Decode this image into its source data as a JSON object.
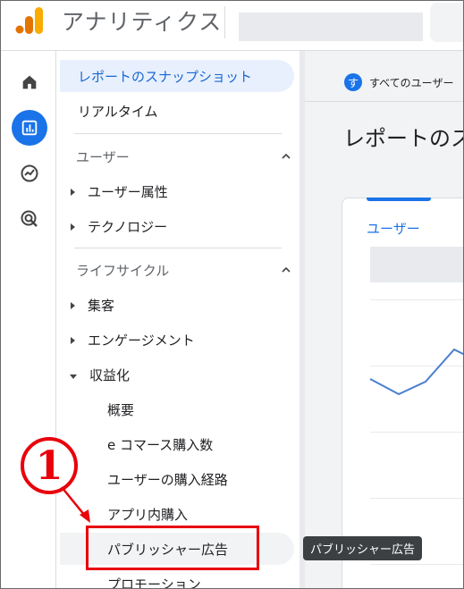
{
  "app": {
    "title": "アナリティクス"
  },
  "filter_chip": {
    "badge": "す",
    "label": "すべてのユーザー"
  },
  "report": {
    "title": "レポートのスナップショット"
  },
  "card": {
    "metric_label": "ユーザー"
  },
  "nav": {
    "report_snapshot": "レポートのスナップショット",
    "realtime": "リアルタイム",
    "user_section": "ユーザー",
    "user_attributes": "ユーザー属性",
    "technology": "テクノロジー",
    "lifecycle_section": "ライフサイクル",
    "acquisition": "集客",
    "engagement": "エンゲージメント",
    "monetization": "収益化",
    "overview": "概要",
    "ecommerce": "e コマース購入数",
    "purchase_journey": "ユーザーの購入経路",
    "in_app": "アプリ内購入",
    "publisher_ads": "パブリッシャー広告",
    "promotions": "プロモーション"
  },
  "annotation": {
    "step": "1"
  },
  "tooltip": {
    "text": "パブリッシャー広告"
  },
  "colors": {
    "accent": "#1a73e8",
    "annotation_red": "#e8000b",
    "logo_orange": "#f9ab00",
    "logo_dark": "#e37400"
  },
  "icons": [
    "analytics-logo-icon",
    "home-icon",
    "reports-icon",
    "explore-icon",
    "advertising-icon"
  ]
}
